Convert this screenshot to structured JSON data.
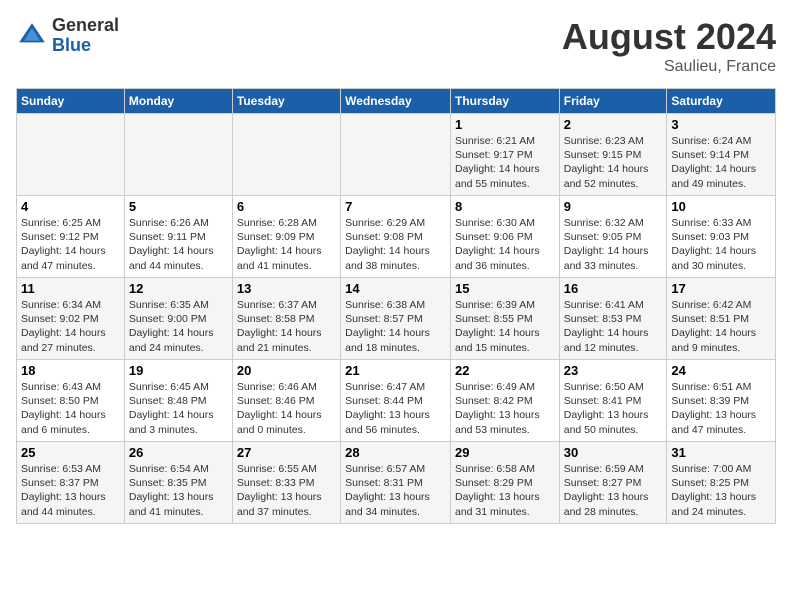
{
  "header": {
    "logo_general": "General",
    "logo_blue": "Blue",
    "month_year": "August 2024",
    "location": "Saulieu, France"
  },
  "days_of_week": [
    "Sunday",
    "Monday",
    "Tuesday",
    "Wednesday",
    "Thursday",
    "Friday",
    "Saturday"
  ],
  "weeks": [
    [
      {
        "day": "",
        "info": ""
      },
      {
        "day": "",
        "info": ""
      },
      {
        "day": "",
        "info": ""
      },
      {
        "day": "",
        "info": ""
      },
      {
        "day": "1",
        "info": "Sunrise: 6:21 AM\nSunset: 9:17 PM\nDaylight: 14 hours\nand 55 minutes."
      },
      {
        "day": "2",
        "info": "Sunrise: 6:23 AM\nSunset: 9:15 PM\nDaylight: 14 hours\nand 52 minutes."
      },
      {
        "day": "3",
        "info": "Sunrise: 6:24 AM\nSunset: 9:14 PM\nDaylight: 14 hours\nand 49 minutes."
      }
    ],
    [
      {
        "day": "4",
        "info": "Sunrise: 6:25 AM\nSunset: 9:12 PM\nDaylight: 14 hours\nand 47 minutes."
      },
      {
        "day": "5",
        "info": "Sunrise: 6:26 AM\nSunset: 9:11 PM\nDaylight: 14 hours\nand 44 minutes."
      },
      {
        "day": "6",
        "info": "Sunrise: 6:28 AM\nSunset: 9:09 PM\nDaylight: 14 hours\nand 41 minutes."
      },
      {
        "day": "7",
        "info": "Sunrise: 6:29 AM\nSunset: 9:08 PM\nDaylight: 14 hours\nand 38 minutes."
      },
      {
        "day": "8",
        "info": "Sunrise: 6:30 AM\nSunset: 9:06 PM\nDaylight: 14 hours\nand 36 minutes."
      },
      {
        "day": "9",
        "info": "Sunrise: 6:32 AM\nSunset: 9:05 PM\nDaylight: 14 hours\nand 33 minutes."
      },
      {
        "day": "10",
        "info": "Sunrise: 6:33 AM\nSunset: 9:03 PM\nDaylight: 14 hours\nand 30 minutes."
      }
    ],
    [
      {
        "day": "11",
        "info": "Sunrise: 6:34 AM\nSunset: 9:02 PM\nDaylight: 14 hours\nand 27 minutes."
      },
      {
        "day": "12",
        "info": "Sunrise: 6:35 AM\nSunset: 9:00 PM\nDaylight: 14 hours\nand 24 minutes."
      },
      {
        "day": "13",
        "info": "Sunrise: 6:37 AM\nSunset: 8:58 PM\nDaylight: 14 hours\nand 21 minutes."
      },
      {
        "day": "14",
        "info": "Sunrise: 6:38 AM\nSunset: 8:57 PM\nDaylight: 14 hours\nand 18 minutes."
      },
      {
        "day": "15",
        "info": "Sunrise: 6:39 AM\nSunset: 8:55 PM\nDaylight: 14 hours\nand 15 minutes."
      },
      {
        "day": "16",
        "info": "Sunrise: 6:41 AM\nSunset: 8:53 PM\nDaylight: 14 hours\nand 12 minutes."
      },
      {
        "day": "17",
        "info": "Sunrise: 6:42 AM\nSunset: 8:51 PM\nDaylight: 14 hours\nand 9 minutes."
      }
    ],
    [
      {
        "day": "18",
        "info": "Sunrise: 6:43 AM\nSunset: 8:50 PM\nDaylight: 14 hours\nand 6 minutes."
      },
      {
        "day": "19",
        "info": "Sunrise: 6:45 AM\nSunset: 8:48 PM\nDaylight: 14 hours\nand 3 minutes."
      },
      {
        "day": "20",
        "info": "Sunrise: 6:46 AM\nSunset: 8:46 PM\nDaylight: 14 hours\nand 0 minutes."
      },
      {
        "day": "21",
        "info": "Sunrise: 6:47 AM\nSunset: 8:44 PM\nDaylight: 13 hours\nand 56 minutes."
      },
      {
        "day": "22",
        "info": "Sunrise: 6:49 AM\nSunset: 8:42 PM\nDaylight: 13 hours\nand 53 minutes."
      },
      {
        "day": "23",
        "info": "Sunrise: 6:50 AM\nSunset: 8:41 PM\nDaylight: 13 hours\nand 50 minutes."
      },
      {
        "day": "24",
        "info": "Sunrise: 6:51 AM\nSunset: 8:39 PM\nDaylight: 13 hours\nand 47 minutes."
      }
    ],
    [
      {
        "day": "25",
        "info": "Sunrise: 6:53 AM\nSunset: 8:37 PM\nDaylight: 13 hours\nand 44 minutes."
      },
      {
        "day": "26",
        "info": "Sunrise: 6:54 AM\nSunset: 8:35 PM\nDaylight: 13 hours\nand 41 minutes."
      },
      {
        "day": "27",
        "info": "Sunrise: 6:55 AM\nSunset: 8:33 PM\nDaylight: 13 hours\nand 37 minutes."
      },
      {
        "day": "28",
        "info": "Sunrise: 6:57 AM\nSunset: 8:31 PM\nDaylight: 13 hours\nand 34 minutes."
      },
      {
        "day": "29",
        "info": "Sunrise: 6:58 AM\nSunset: 8:29 PM\nDaylight: 13 hours\nand 31 minutes."
      },
      {
        "day": "30",
        "info": "Sunrise: 6:59 AM\nSunset: 8:27 PM\nDaylight: 13 hours\nand 28 minutes."
      },
      {
        "day": "31",
        "info": "Sunrise: 7:00 AM\nSunset: 8:25 PM\nDaylight: 13 hours\nand 24 minutes."
      }
    ]
  ]
}
